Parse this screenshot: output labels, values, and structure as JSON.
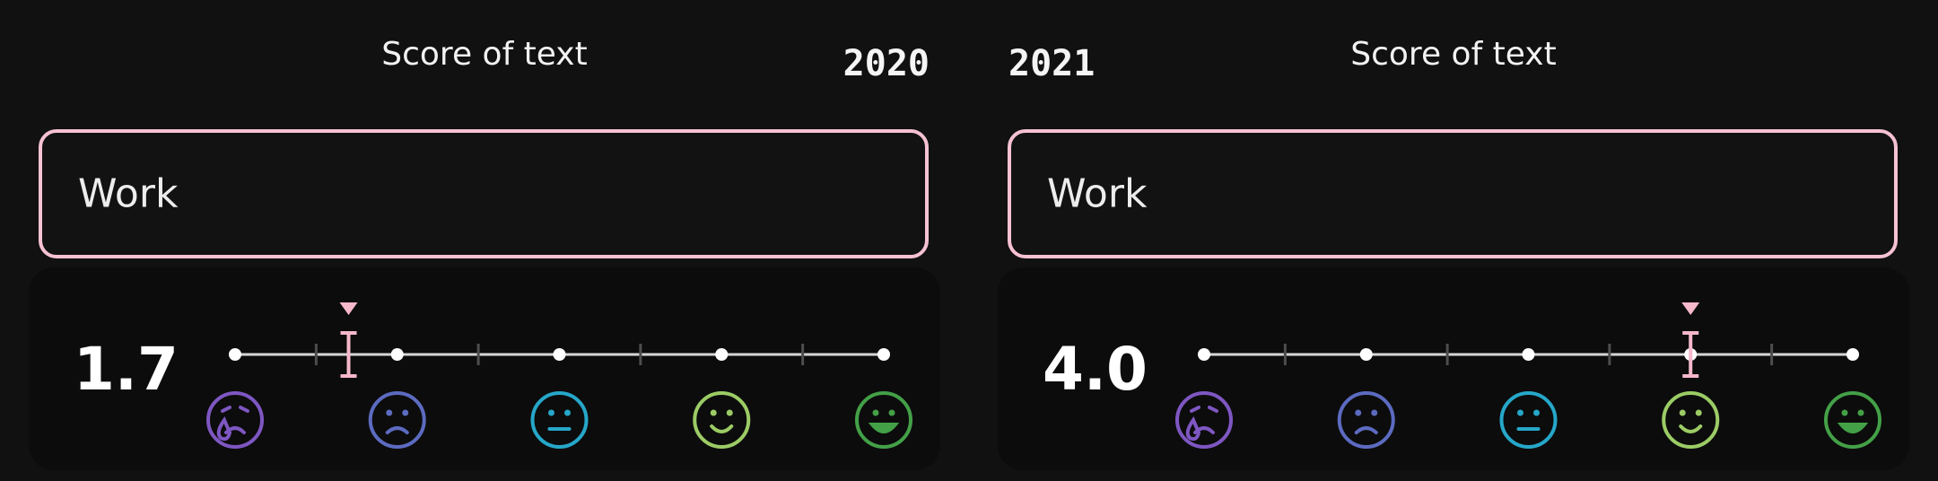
{
  "panels": [
    {
      "title": "Score of text",
      "year": "2020",
      "text_value": "Work",
      "score_display": "1.7",
      "score": 1.7,
      "slider": {
        "min": 1,
        "max": 5,
        "marker_color": "#f6b8cb"
      },
      "mood_icons": [
        {
          "name": "very-sad-face-icon",
          "color": "#7e57c2"
        },
        {
          "name": "sad-face-icon",
          "color": "#5c6bc0"
        },
        {
          "name": "neutral-face-icon",
          "color": "#26a7c9"
        },
        {
          "name": "happy-face-icon",
          "color": "#9ccc65"
        },
        {
          "name": "very-happy-face-icon",
          "color": "#43a047"
        }
      ]
    },
    {
      "title": "Score of text",
      "year": "2021",
      "text_value": "Work",
      "score_display": "4.0",
      "score": 4.0,
      "slider": {
        "min": 1,
        "max": 5,
        "marker_color": "#f6b8cb"
      },
      "mood_icons": [
        {
          "name": "very-sad-face-icon",
          "color": "#7e57c2"
        },
        {
          "name": "sad-face-icon",
          "color": "#5c6bc0"
        },
        {
          "name": "neutral-face-icon",
          "color": "#26a7c9"
        },
        {
          "name": "happy-face-icon",
          "color": "#9ccc65"
        },
        {
          "name": "very-happy-face-icon",
          "color": "#43a047"
        }
      ]
    }
  ],
  "colors": {
    "background": "#111111",
    "card": "#0c0c0c",
    "field_border": "#f6c2d2",
    "track": "#d6d6d6",
    "tick": "#4d4d4d"
  }
}
